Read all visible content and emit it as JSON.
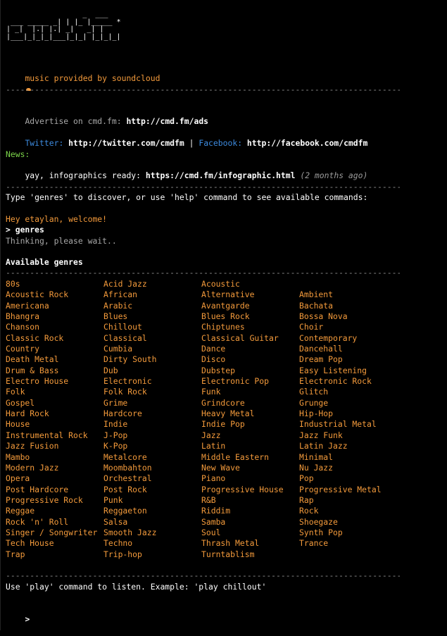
{
  "logo_ascii": "                  _  ___\n ___ _____ _| | |_ |_____ *\n| _|  |.| |.| _|   _| |\n|___|_|_|_|___|_|_| |_|_|_|",
  "soundcloud_line": "music provided by soundcloud",
  "soundcloud_icon": "cloud-icon",
  "separator": "----------------------------------------------------------------------------------------------------------",
  "advertise": {
    "label": "Advertise on cmd.fm: ",
    "url": "http://cmd.fm/ads"
  },
  "social": {
    "twitter_label": "Twitter: ",
    "twitter_url": "http://twitter.com/cmdfm",
    "divider": " | ",
    "facebook_label": "Facebook: ",
    "facebook_url": "http://facebook.com/cmdfm"
  },
  "news": {
    "label": "News:",
    "text": "yay, infographics ready: ",
    "url": "https://cmd.fm/infographic.html",
    "age": "(2 months ago)"
  },
  "intro": "Type 'genres' to discover, or use 'help' command to see available commands:",
  "welcome": "Hey etaylan, welcome!",
  "command": "> genres",
  "thinking": "Thinking, please wait..",
  "genres_title": "Available genres",
  "genres": [
    "80s",
    "Acid Jazz",
    "Acoustic",
    "",
    "Acoustic Rock",
    "African",
    "Alternative",
    "Ambient",
    "Americana",
    "Arabic",
    "Avantgarde",
    "Bachata",
    "Bhangra",
    "Blues",
    "Blues Rock",
    "Bossa Nova",
    "Chanson",
    "Chillout",
    "Chiptunes",
    "Choir",
    "Classic Rock",
    "Classical",
    "Classical Guitar",
    "Contemporary",
    "Country",
    "Cumbia",
    "Dance",
    "Dancehall",
    "Death Metal",
    "Dirty South",
    "Disco",
    "Dream Pop",
    "Drum & Bass",
    "Dub",
    "Dubstep",
    "Easy Listening",
    "Electro House",
    "Electronic",
    "Electronic Pop",
    "Electronic Rock",
    "Folk",
    "Folk Rock",
    "Funk",
    "Glitch",
    "Gospel",
    "Grime",
    "Grindcore",
    "Grunge",
    "Hard Rock",
    "Hardcore",
    "Heavy Metal",
    "Hip-Hop",
    "House",
    "Indie",
    "Indie Pop",
    "Industrial Metal",
    "Instrumental Rock",
    "J-Pop",
    "Jazz",
    "Jazz Funk",
    "Jazz Fusion",
    "K-Pop",
    "Latin",
    "Latin Jazz",
    "Mambo",
    "Metalcore",
    "Middle Eastern",
    "Minimal",
    "Modern Jazz",
    "Moombahton",
    "New Wave",
    "Nu Jazz",
    "Opera",
    "Orchestral",
    "Piano",
    "Pop",
    "Post Hardcore",
    "Post Rock",
    "Progressive House",
    "Progressive Metal",
    "Progressive Rock",
    "Punk",
    "R&B",
    "Rap",
    "Reggae",
    "Reggaeton",
    "Riddim",
    "Rock",
    "Rock 'n' Roll",
    "Salsa",
    "Samba",
    "Shoegaze",
    "Singer / Songwriter",
    "Smooth Jazz",
    "Soul",
    "Synth Pop",
    "Tech House",
    "Techno",
    "Thrash Metal",
    "Trance",
    "Trap",
    "Trip-hop",
    "Turntablism",
    ""
  ],
  "play_hint": "Use 'play' command to listen. Example: 'play chillout'",
  "prompt": ">",
  "colors": {
    "accent": "#f39a3b",
    "news": "#7bd44a",
    "facebook": "#3d8be0",
    "background": "#000000"
  }
}
